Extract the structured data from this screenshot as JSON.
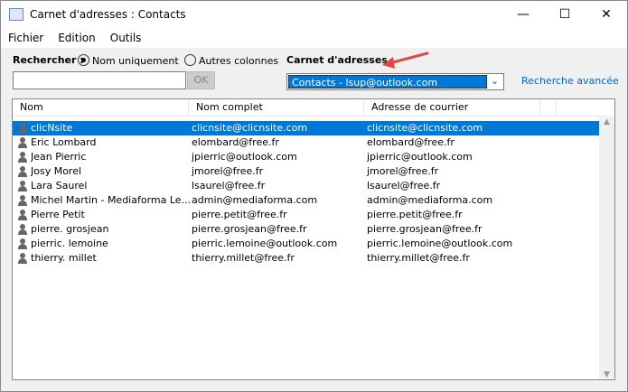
{
  "window": {
    "title": "Carnet d'adresses : Contacts",
    "minimize": "—",
    "maximize": "☐",
    "close": "✕"
  },
  "menu": [
    "Fichier",
    "Edition",
    "Outils"
  ],
  "search": {
    "label": "Rechercher :",
    "option1": "Nom uniquement",
    "option2": "Autres colonnes",
    "value": "",
    "ok": "OK"
  },
  "addressbook": {
    "label": "Carnet d'adresses",
    "selected": "Contacts - lsup@outlook.com",
    "advanced": "Recherche avancée"
  },
  "columns": [
    "Nom",
    "Nom complet",
    "Adresse de courrier"
  ],
  "rows": [
    [
      "clicNsite",
      "clicnsite@clicnsite.com",
      "clicnsite@clicnsite.com"
    ],
    [
      "Eric Lombard",
      "elombard@free.fr",
      "elombard@free.fr"
    ],
    [
      "Jean Pierric",
      "jpierric@outlook.com",
      "jpierric@outlook.com"
    ],
    [
      "Josy Morel",
      "jmorel@free.fr",
      "jmorel@free.fr"
    ],
    [
      "Lara Saurel",
      "lsaurel@free.fr",
      "lsaurel@free.fr"
    ],
    [
      "Michel Martin - Mediaforma Le...",
      "admin@mediaforma.com",
      "admin@mediaforma.com"
    ],
    [
      "Pierre Petit",
      "pierre.petit@free.fr",
      "pierre.petit@free.fr"
    ],
    [
      "pierre. grosjean",
      "pierre.grosjean@free.fr",
      "pierre.grosjean@free.fr"
    ],
    [
      "pierric. lemoine",
      "pierric.lemoine@outlook.com",
      "pierric.lemoine@outlook.com"
    ],
    [
      "thierry. millet",
      "thierry.millet@free.fr",
      "thierry.millet@free.fr"
    ]
  ],
  "colors": {
    "accent": "#0078d7",
    "link": "#0066cc",
    "arrow": "#e04848"
  }
}
